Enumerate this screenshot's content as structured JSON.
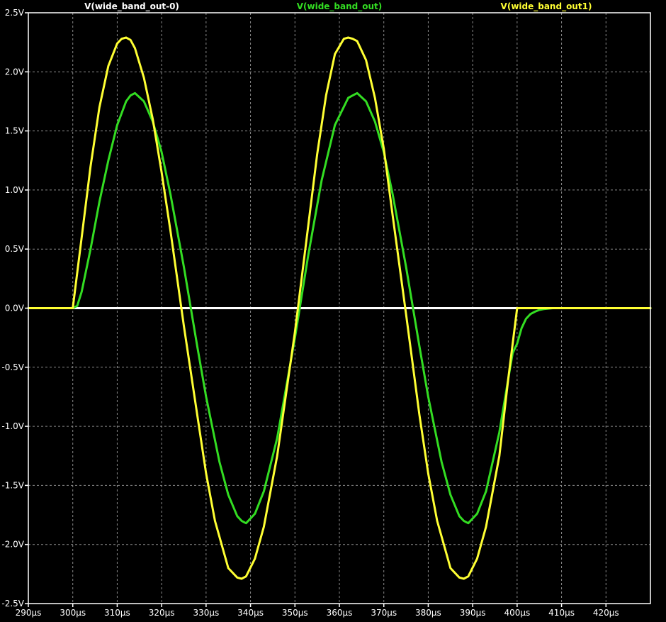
{
  "chart_data": {
    "type": "line",
    "title": "",
    "xlabel": "",
    "ylabel": "",
    "xlim": [
      290,
      430
    ],
    "ylim": [
      -2.5,
      2.5
    ],
    "grid": true,
    "legend_position": "top",
    "background": "#000000",
    "axis_color": "#ffffff",
    "grid_color": "#8a8a8a",
    "x_tick_values": [
      290,
      300,
      310,
      320,
      330,
      340,
      350,
      360,
      370,
      380,
      390,
      400,
      410,
      420
    ],
    "x_tick_labels": [
      "290µs",
      "300µs",
      "310µs",
      "320µs",
      "330µs",
      "340µs",
      "350µs",
      "360µs",
      "370µs",
      "380µs",
      "390µs",
      "400µs",
      "410µs",
      "420µs"
    ],
    "y_tick_values": [
      2.5,
      2.0,
      1.5,
      1.0,
      0.5,
      0.0,
      -0.5,
      -1.0,
      -1.5,
      -2.0,
      -2.5
    ],
    "y_tick_labels": [
      "2.5V",
      "2.0V",
      "1.5V",
      "1.0V",
      "0.5V",
      "0.0V",
      "-0.5V",
      "-1.0V",
      "-1.5V",
      "-2.0V",
      "-2.5V"
    ],
    "series": [
      {
        "name": "V(wide_band_out-0)",
        "color": "#ffffff",
        "x": [
          290,
          430
        ],
        "y": [
          0,
          0
        ]
      },
      {
        "name": "V(wide_band_out)",
        "color": "#33dd22",
        "x": [
          290,
          300,
          301,
          302,
          304,
          306,
          308,
          310,
          312,
          313,
          314,
          316,
          318,
          320,
          322,
          325,
          328,
          330,
          333,
          335,
          337,
          338,
          339,
          341,
          343,
          346,
          350,
          353,
          356,
          359,
          362,
          363,
          364,
          366,
          368,
          370,
          372,
          375,
          378,
          380,
          383,
          385,
          387,
          388,
          389,
          391,
          393,
          396,
          398,
          399,
          400,
          401,
          402,
          403,
          404,
          405,
          406,
          408,
          410,
          430
        ],
        "y": [
          0,
          0,
          0.02,
          0.14,
          0.5,
          0.9,
          1.25,
          1.55,
          1.75,
          1.8,
          1.82,
          1.75,
          1.58,
          1.32,
          0.96,
          0.35,
          -0.32,
          -0.75,
          -1.3,
          -1.58,
          -1.76,
          -1.8,
          -1.82,
          -1.74,
          -1.55,
          -1.1,
          -0.25,
          0.45,
          1.08,
          1.55,
          1.78,
          1.8,
          1.82,
          1.75,
          1.58,
          1.32,
          0.96,
          0.35,
          -0.32,
          -0.75,
          -1.3,
          -1.58,
          -1.76,
          -1.8,
          -1.82,
          -1.74,
          -1.55,
          -1.05,
          -0.6,
          -0.38,
          -0.3,
          -0.17,
          -0.09,
          -0.05,
          -0.03,
          -0.015,
          -0.008,
          0,
          0,
          0
        ]
      },
      {
        "name": "V(wide_band_out1)",
        "color": "#ffff33",
        "x": [
          290,
          300,
          302,
          304,
          306,
          308,
          310,
          311,
          312,
          313,
          314,
          316,
          318,
          320,
          322,
          325,
          328,
          330,
          332,
          335,
          337,
          338,
          339,
          341,
          343,
          346,
          350,
          353,
          355,
          357,
          359,
          361,
          362,
          363,
          364,
          366,
          368,
          370,
          372,
          375,
          378,
          380,
          382,
          385,
          387,
          388,
          389,
          391,
          393,
          396,
          398,
          400,
          430
        ],
        "y": [
          0,
          0,
          0.6,
          1.2,
          1.7,
          2.05,
          2.24,
          2.28,
          2.29,
          2.27,
          2.2,
          1.95,
          1.6,
          1.15,
          0.65,
          -0.15,
          -0.9,
          -1.4,
          -1.8,
          -2.2,
          -2.28,
          -2.29,
          -2.27,
          -2.12,
          -1.85,
          -1.25,
          -0.2,
          0.7,
          1.3,
          1.8,
          2.15,
          2.28,
          2.29,
          2.28,
          2.26,
          2.1,
          1.78,
          1.35,
          0.78,
          -0.05,
          -0.9,
          -1.4,
          -1.8,
          -2.2,
          -2.28,
          -2.29,
          -2.27,
          -2.12,
          -1.85,
          -1.25,
          -0.6,
          0,
          0
        ]
      }
    ]
  }
}
